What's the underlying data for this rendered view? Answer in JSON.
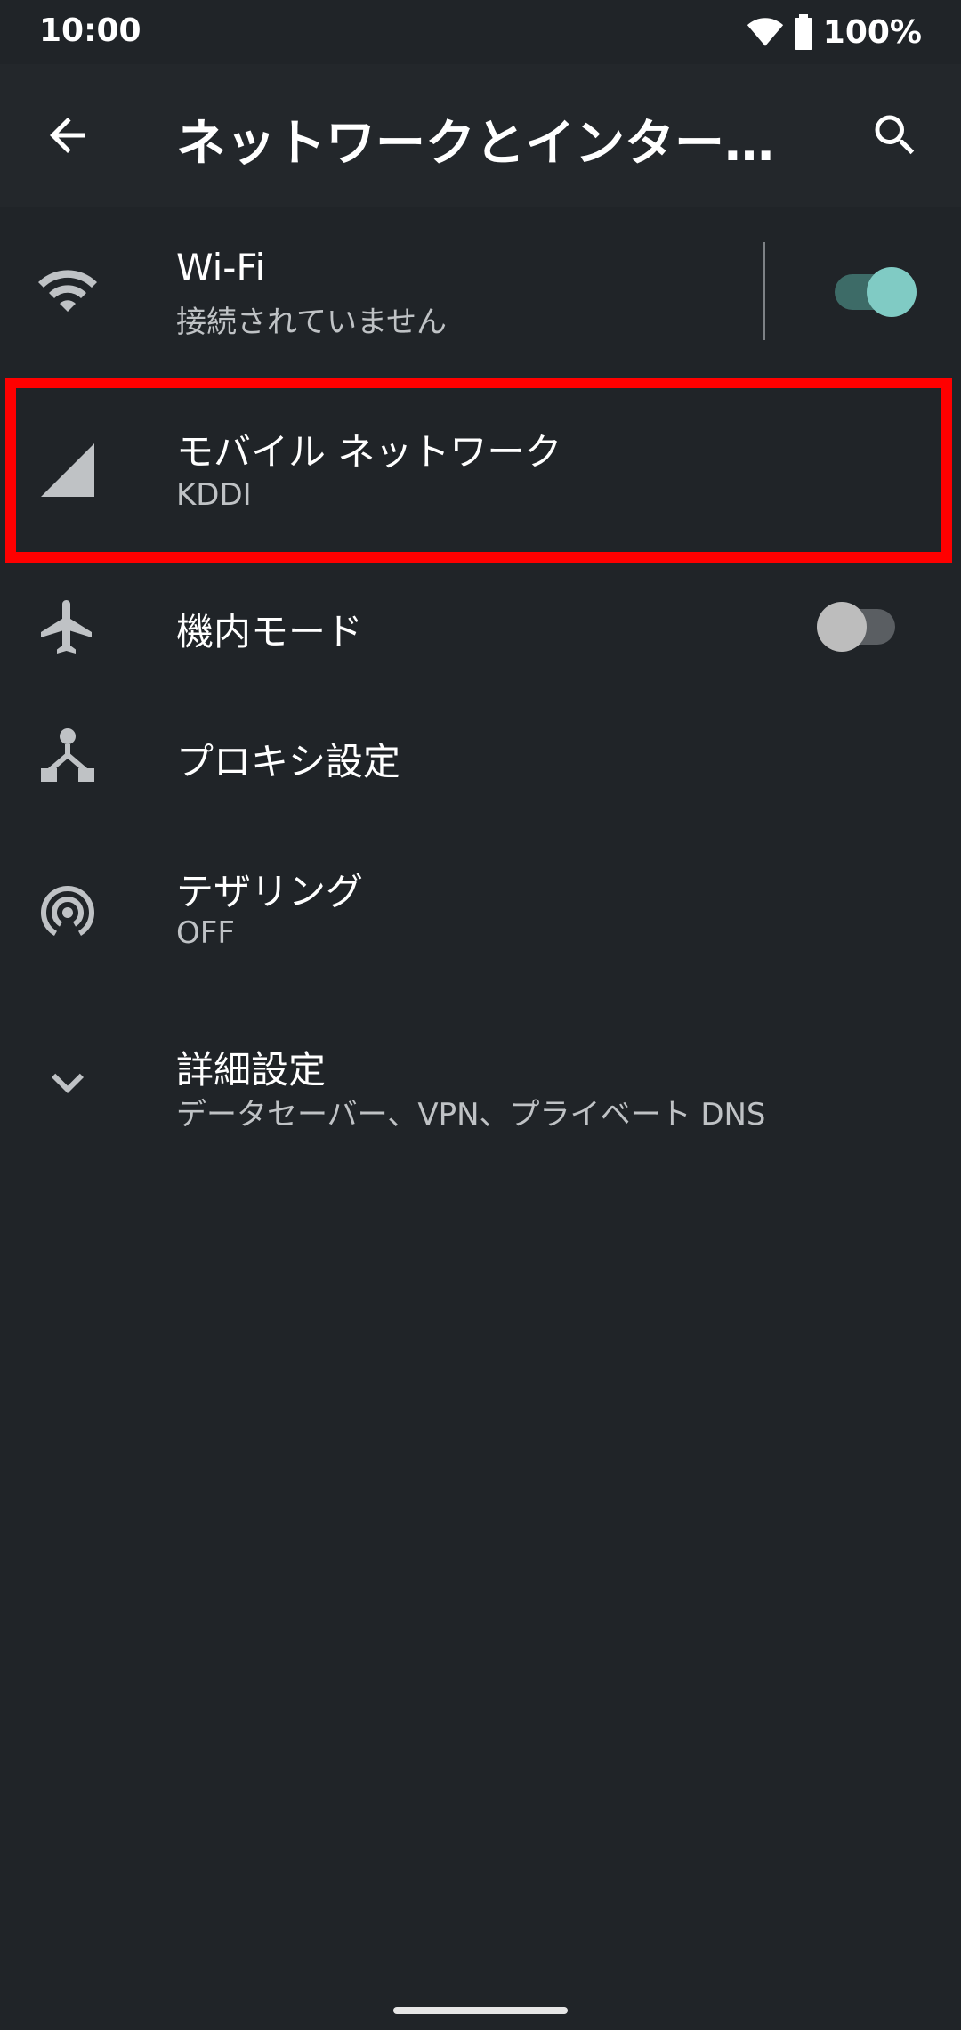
{
  "status_bar": {
    "time": "10:00",
    "battery": "100%",
    "icons": [
      "wifi-icon",
      "battery-icon"
    ]
  },
  "app_bar": {
    "title": "ネットワークとインターネット",
    "icons": [
      "back-arrow-icon",
      "search-icon"
    ]
  },
  "items": {
    "wifi": {
      "title": "Wi-Fi",
      "subtitle": "接続されていません",
      "toggle_on": true,
      "icon": "wifi-icon"
    },
    "mobile": {
      "title": "モバイル ネットワーク",
      "subtitle": "KDDI",
      "icon": "signal-icon"
    },
    "airplane": {
      "title": "機内モード",
      "toggle_on": false,
      "icon": "airplane-icon"
    },
    "proxy": {
      "title": "プロキシ設定",
      "icon": "proxy-icon"
    },
    "tethering": {
      "title": "テザリング",
      "subtitle": "OFF",
      "icon": "hotspot-icon"
    },
    "advanced": {
      "title": "詳細設定",
      "subtitle": "データセーバー、VPN、プライベート DNS",
      "icon": "chevron-down-icon"
    }
  },
  "colors": {
    "background": "#202428",
    "accent": "#80cbc4",
    "highlight": "#ff0000"
  }
}
